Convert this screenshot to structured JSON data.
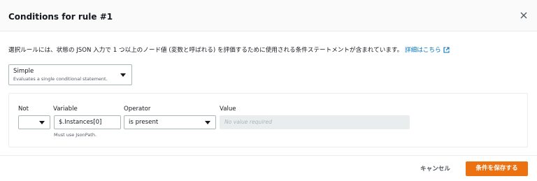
{
  "modal": {
    "title": "Conditions for rule #1",
    "description": "選択ルールには、状態の JSON 入力で 1 つ以上のノード値 (変数と呼ばれる) を評価するために使用される条件ステートメントが含まれています。",
    "details_link": "詳細はこちら",
    "close_icon": "close-icon",
    "external_link_icon": "external-link-icon"
  },
  "mode_select": {
    "value": "Simple",
    "hint": "Evaluates a single conditional statement."
  },
  "condition": {
    "not_label": "Not",
    "not_value": "",
    "variable_label": "Variable",
    "variable_value": "$.Instances[0]",
    "variable_hint": "Must use JsonPath.",
    "operator_label": "Operator",
    "operator_value": "is present",
    "value_label": "Value",
    "value_placeholder": "No value required"
  },
  "footer": {
    "cancel_label": "キャンセル",
    "save_label": "条件を保存する"
  },
  "colors": {
    "primary": "#ec7211",
    "link": "#0073bb"
  }
}
